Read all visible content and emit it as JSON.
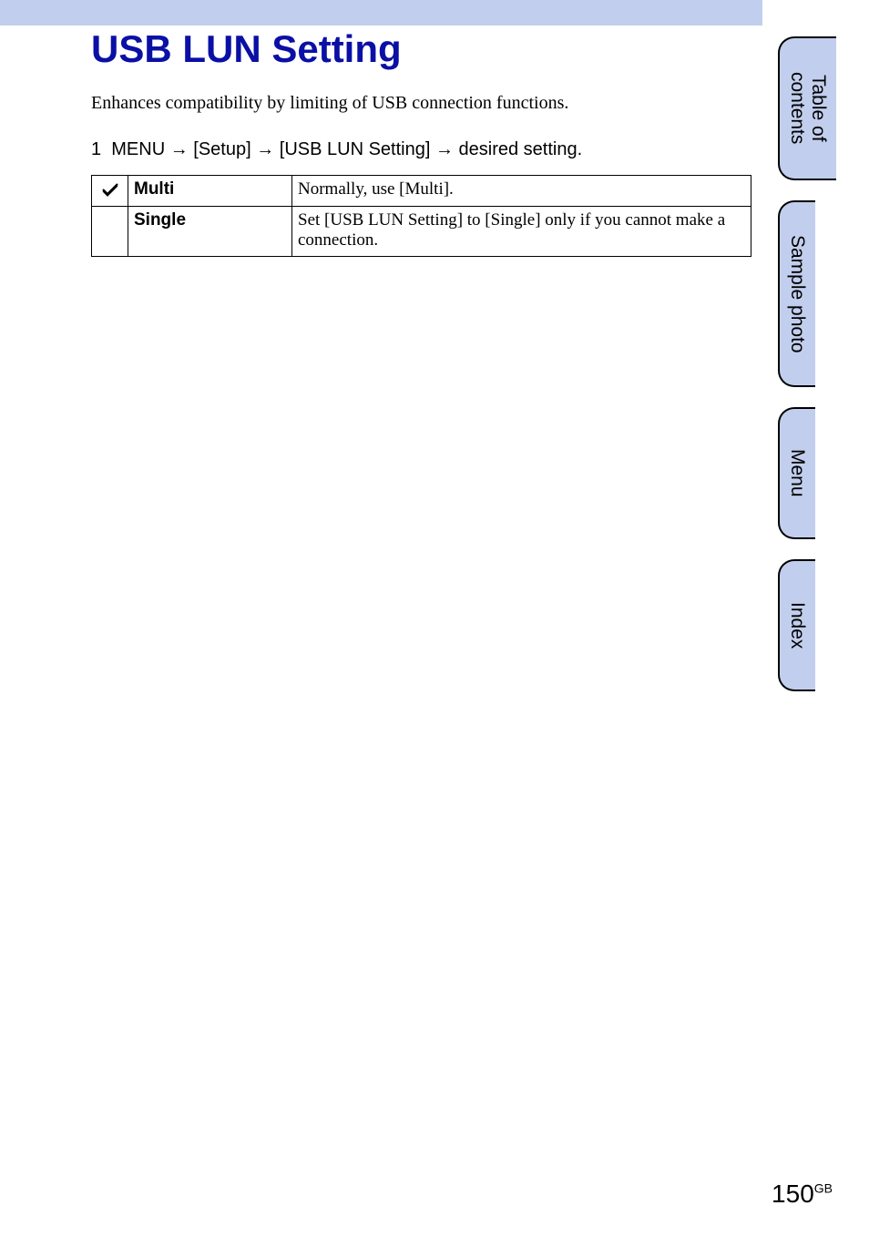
{
  "top_bar_color": "#c2ceed",
  "title": "USB LUN Setting",
  "intro": "Enhances compatibility by limiting of USB connection functions.",
  "step": {
    "number": "1",
    "prefix": "MENU",
    "arrow": "→",
    "part2": "[Setup]",
    "part3": "[USB LUN Setting]",
    "suffix": "desired setting."
  },
  "table": {
    "rows": [
      {
        "checked": true,
        "name": "Multi",
        "desc": "Normally, use [Multi]."
      },
      {
        "checked": false,
        "name": "Single",
        "desc": "Set [USB LUN Setting] to [Single] only if you cannot make a connection."
      }
    ]
  },
  "tabs": [
    {
      "id": "toc",
      "label": "Table of\ncontents"
    },
    {
      "id": "sample",
      "label": "Sample photo"
    },
    {
      "id": "menu",
      "label": "Menu"
    },
    {
      "id": "index",
      "label": "Index"
    }
  ],
  "footer": {
    "page_number": "150",
    "suffix": "GB"
  }
}
